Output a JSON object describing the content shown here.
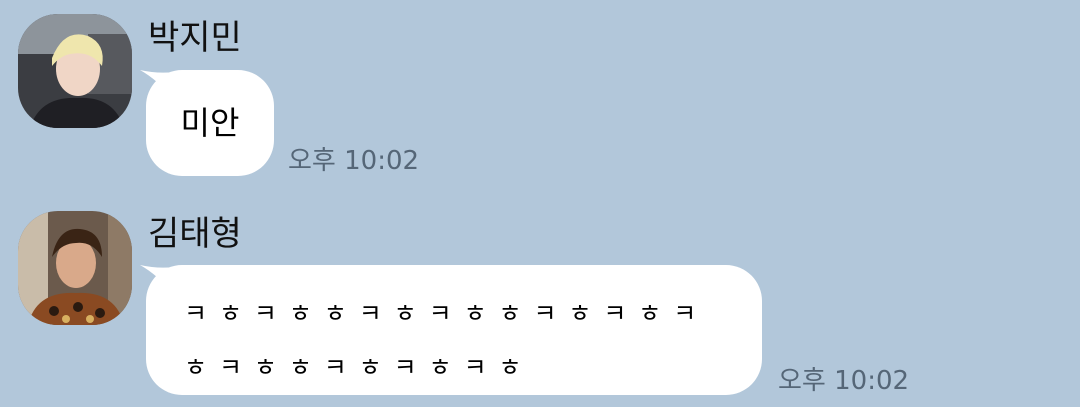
{
  "messages": [
    {
      "sender": "박지민",
      "text": "미안",
      "time": "오후 10:02",
      "avatar_icon": "profile-photo"
    },
    {
      "sender": "김태형",
      "text_lines": [
        "ㅋ ㅎ ㅋ ㅎ ㅎ ㅋ ㅎ ㅋ ㅎ ㅎ ㅋ ㅎ ㅋ ㅎ ㅋ",
        "ㅎ ㅋ ㅎ ㅎ ㅋ ㅎ ㅋ ㅎ ㅋ ㅎ"
      ],
      "time": "오후 10:02",
      "avatar_icon": "profile-photo"
    }
  ],
  "colors": {
    "background": "#b2c7da",
    "bubble": "#ffffff",
    "time_text": "#556677"
  }
}
